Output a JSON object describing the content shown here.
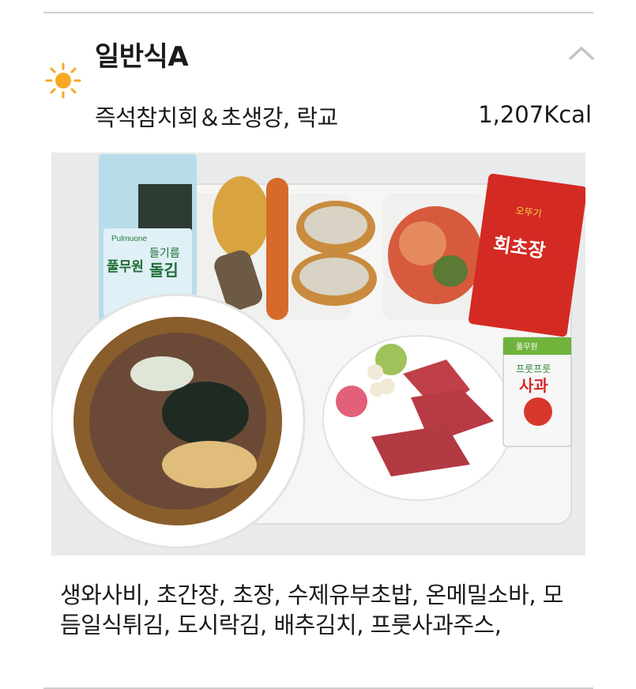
{
  "meal": {
    "title": "일반식A",
    "main_menu": "즉석참치회＆초생강, 락교",
    "calories": "1,207Kcal",
    "side_dishes": "생와사비, 초간장, 초장, 수제유부초밥, 온메밀소바, 모듬일식튀김, 도시락김, 배추김치, 프룻사과주스,"
  },
  "photo_labels": {
    "seaweed_brand": "풀무원",
    "seaweed_name": "들기름",
    "seaweed_name2": "돌김",
    "seaweed_maker": "Pulmuone",
    "sauce_text": "회초장",
    "sauce_brand": "오뚜기",
    "juice_brand": "풀무원",
    "juice_line": "프룻프룻",
    "juice_name": "사과"
  },
  "icons": {
    "meal_time": "sun-icon",
    "toggle": "chevron-up-icon"
  },
  "colors": {
    "sun": "#f7a823",
    "divider": "#cfcfcf",
    "chevron": "#c4c4c4"
  }
}
